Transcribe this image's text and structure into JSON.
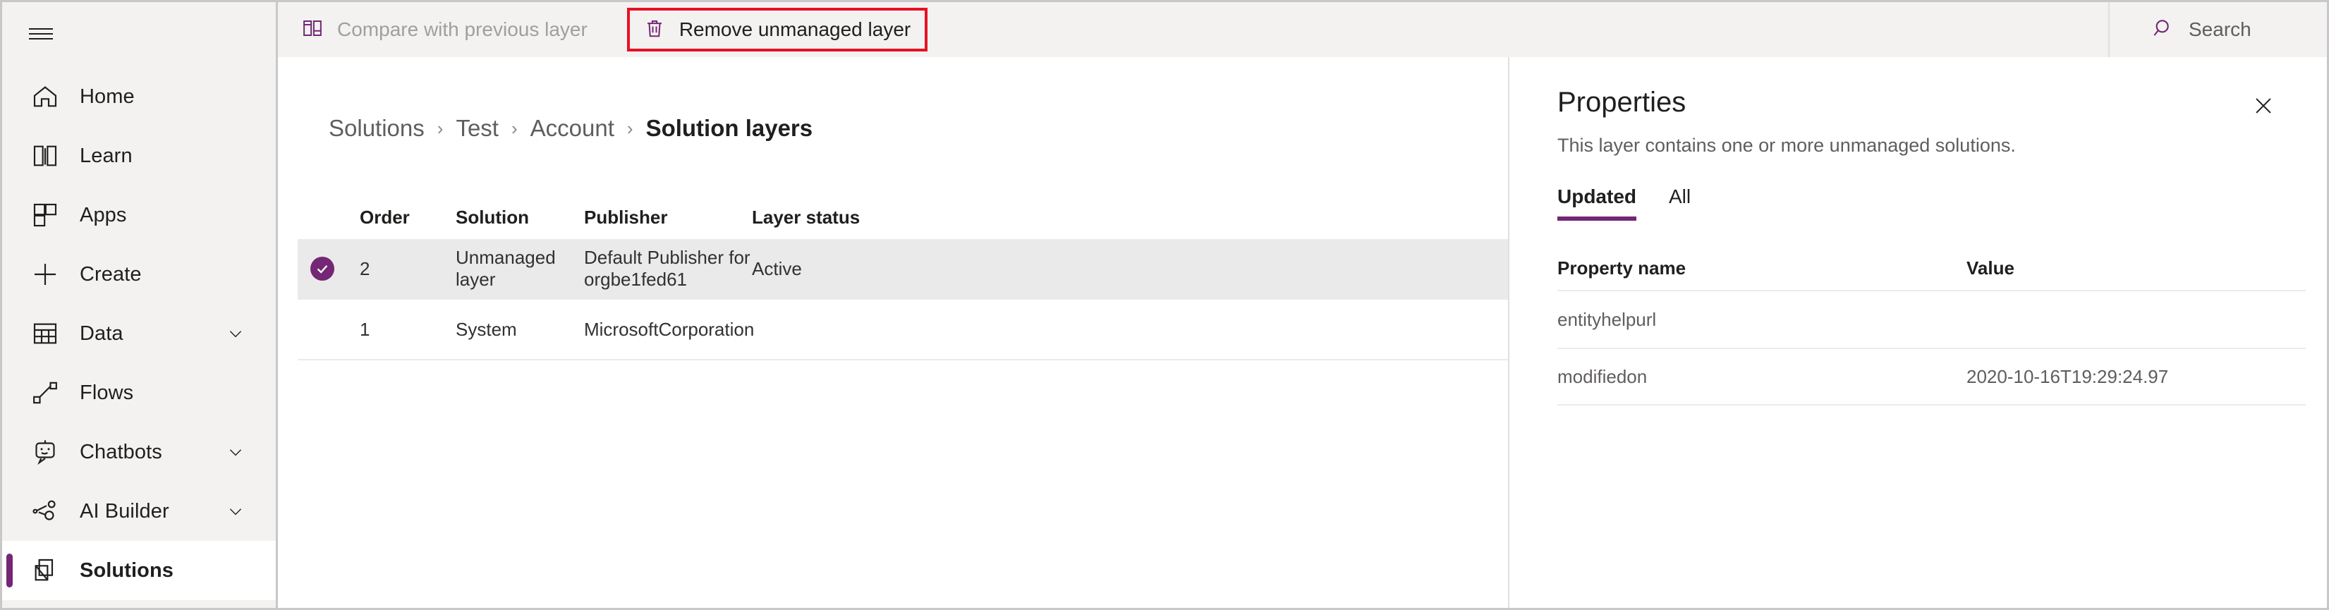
{
  "sidebar": {
    "menu_icon": "hamburger-icon",
    "items": [
      {
        "label": "Home",
        "icon": "home-icon",
        "chevron": false,
        "active": false
      },
      {
        "label": "Learn",
        "icon": "book-icon",
        "chevron": false,
        "active": false
      },
      {
        "label": "Apps",
        "icon": "apps-grid-icon",
        "chevron": false,
        "active": false
      },
      {
        "label": "Create",
        "icon": "plus-icon",
        "chevron": false,
        "active": false
      },
      {
        "label": "Data",
        "icon": "table-icon",
        "chevron": true,
        "active": false
      },
      {
        "label": "Flows",
        "icon": "flows-icon",
        "chevron": true,
        "active": false
      },
      {
        "label": "Chatbots",
        "icon": "chatbot-icon",
        "chevron": true,
        "active": false
      },
      {
        "label": "AI Builder",
        "icon": "ai-builder-icon",
        "chevron": true,
        "active": false
      },
      {
        "label": "Solutions",
        "icon": "solutions-icon",
        "chevron": false,
        "active": true
      }
    ]
  },
  "commandbar": {
    "compare_label": "Compare with previous layer",
    "compare_icon": "compare-layers-icon",
    "compare_disabled": true,
    "remove_label": "Remove unmanaged layer",
    "remove_icon": "trash-icon",
    "remove_highlighted": true,
    "highlight_color": "#e81123"
  },
  "search": {
    "label": "Search",
    "placeholder": "Search",
    "icon": "search-icon"
  },
  "breadcrumb": {
    "items": [
      "Solutions",
      "Test",
      "Account",
      "Solution layers"
    ],
    "separator": "›",
    "current_index": 3
  },
  "layers_grid": {
    "columns": [
      "Order",
      "Solution",
      "Publisher",
      "Layer status"
    ],
    "rows": [
      {
        "order": "2",
        "solution": "Unmanaged layer",
        "publisher": "Default Publisher for orgbe1fed61",
        "status": "Active",
        "selected": true,
        "check_icon": "check-circle-icon"
      },
      {
        "order": "1",
        "solution": "System",
        "publisher": "MicrosoftCorporation",
        "status": "",
        "selected": false,
        "check_icon": ""
      }
    ]
  },
  "properties": {
    "title": "Properties",
    "subtitle": "This layer contains one or more unmanaged solutions.",
    "close_icon": "close-icon",
    "tabs": [
      {
        "label": "Updated",
        "active": true
      },
      {
        "label": "All",
        "active": false
      }
    ],
    "columns": [
      "Property name",
      "Value"
    ],
    "rows": [
      {
        "name": "entityhelpurl",
        "value": ""
      },
      {
        "name": "modifiedon",
        "value": "2020-10-16T19:29:24.97"
      }
    ]
  },
  "theme": {
    "accent": "#742774",
    "selected_row_bg": "#eaeaea",
    "chrome_bg": "#f3f2f1"
  }
}
